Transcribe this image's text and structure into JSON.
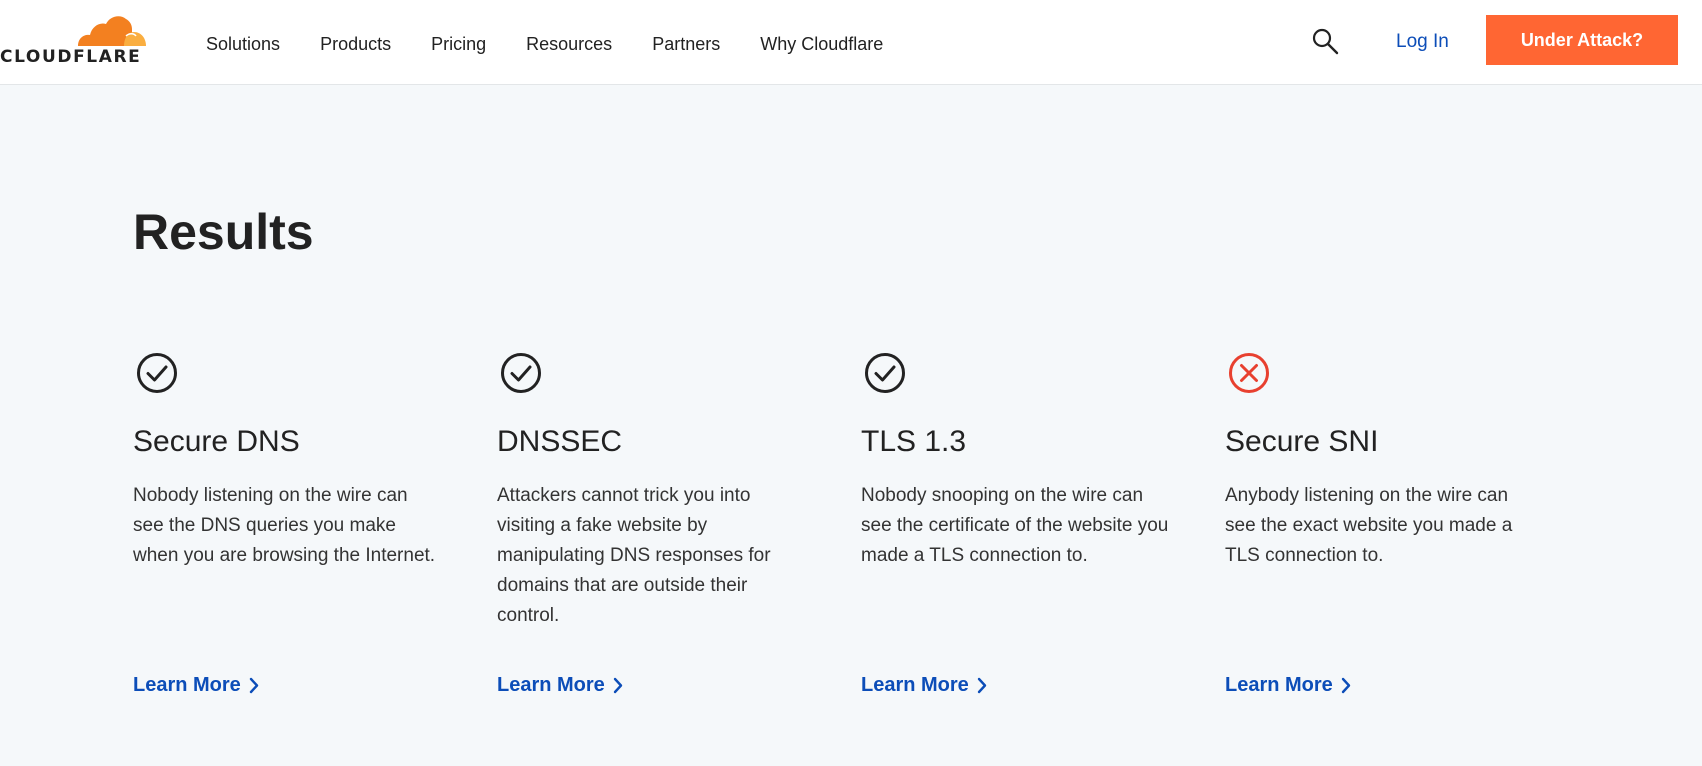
{
  "header": {
    "logo_text": "CLOUDFLARE",
    "nav": [
      "Solutions",
      "Products",
      "Pricing",
      "Resources",
      "Partners",
      "Why Cloudflare"
    ],
    "search_icon": "search-icon",
    "login_label": "Log In",
    "attack_label": "Under Attack?"
  },
  "main": {
    "title": "Results",
    "cards": [
      {
        "status": "pass",
        "icon": "check-circle-icon",
        "title": "Secure DNS",
        "description": "Nobody listening on the wire can see the DNS queries you make when you are browsing the Internet.",
        "link": "Learn More"
      },
      {
        "status": "pass",
        "icon": "check-circle-icon",
        "title": "DNSSEC",
        "description": "Attackers cannot trick you into visiting a fake website by manipulating DNS responses for domains that are outside their control.",
        "link": "Learn More"
      },
      {
        "status": "pass",
        "icon": "check-circle-icon",
        "title": "TLS 1.3",
        "description": "Nobody snooping on the wire can see the certificate of the website you made a TLS connection to.",
        "link": "Learn More"
      },
      {
        "status": "fail",
        "icon": "x-circle-icon",
        "title": "Secure SNI",
        "description": "Anybody listening on the wire can see the exact website you made a TLS connection to.",
        "link": "Learn More"
      }
    ]
  },
  "colors": {
    "brand_orange": "#f38020",
    "attack_button": "#ff6633",
    "link_blue": "#0c4db8",
    "pass_icon": "#222222",
    "fail_icon": "#e8402f",
    "background": "#f5f8fa"
  }
}
